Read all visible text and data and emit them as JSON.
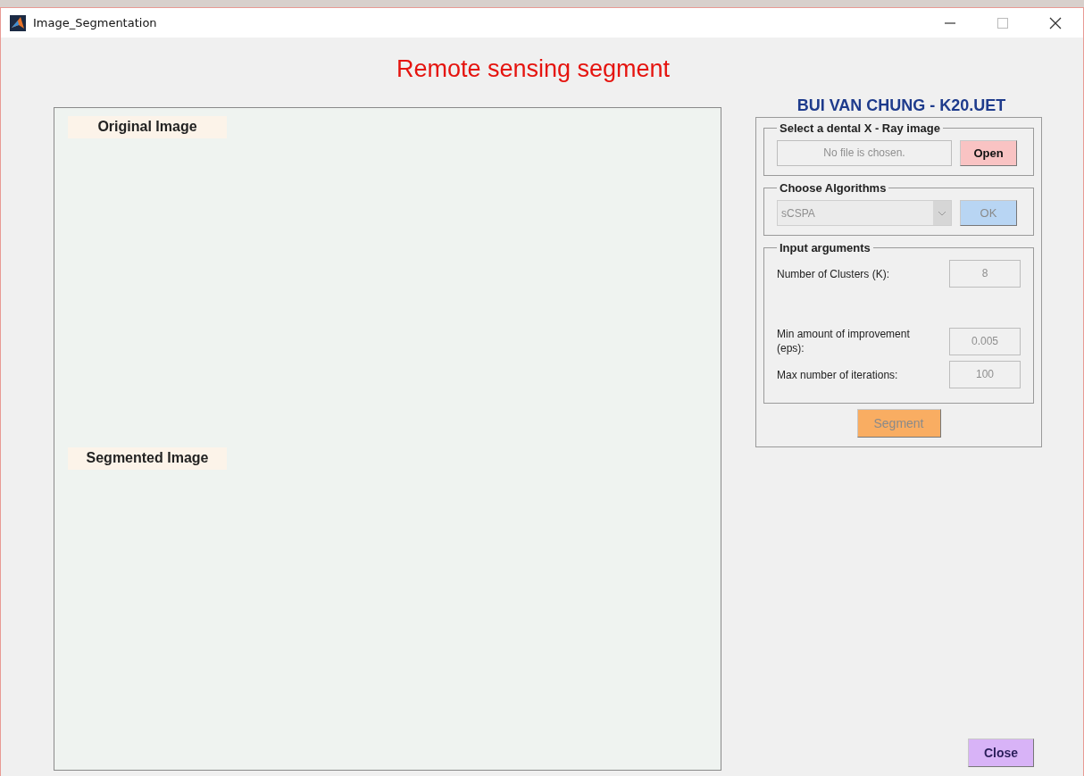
{
  "window": {
    "title": "Image_Segmentation"
  },
  "heading": "Remote sensing segment",
  "author": "BUI VAN CHUNG - K20.UET",
  "axes": [
    {
      "label": "Original Image"
    },
    {
      "label": "Segmented Image"
    }
  ],
  "file_group": {
    "title": "Select a dental X - Ray image",
    "file_field": {
      "value": "No file is chosen.",
      "disabled": true
    },
    "open_button": {
      "label": "Open",
      "disabled": false
    }
  },
  "algorithm_group": {
    "title": "Choose Algorithms",
    "dropdown": {
      "value": "sCSPA",
      "disabled": true
    },
    "ok_button": {
      "label": "OK",
      "disabled": true
    }
  },
  "arguments_group": {
    "title": "Input arguments",
    "fields": [
      {
        "label": "Number of Clusters (K):",
        "value": "8",
        "disabled": true
      },
      {
        "label": "Min amount of improvement (eps):",
        "value": "0.005",
        "disabled": true
      },
      {
        "label": "Max number of iterations:",
        "value": "100",
        "disabled": true
      }
    ]
  },
  "segment_button": {
    "label": "Segment",
    "disabled": true
  },
  "close_button": {
    "label": "Close",
    "disabled": false
  }
}
